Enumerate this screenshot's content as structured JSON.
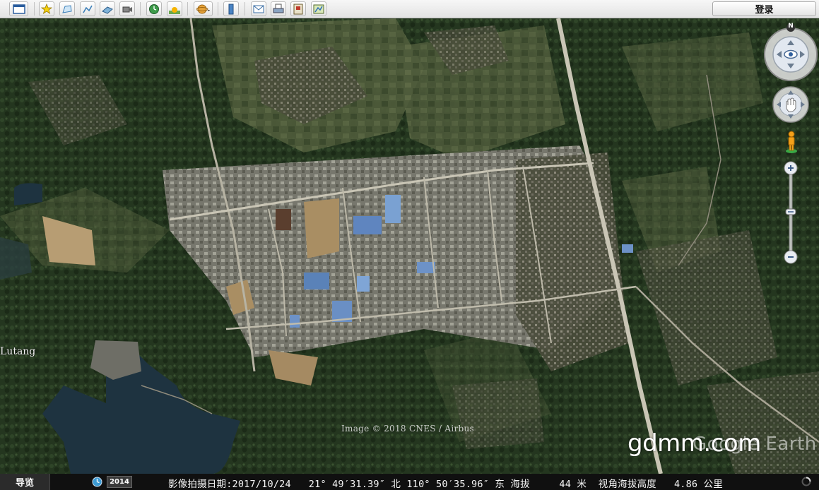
{
  "toolbar": {
    "buttons": [
      {
        "name": "sidebar-toggle-icon"
      },
      {
        "name": "add-placemark-icon"
      },
      {
        "name": "add-polygon-icon"
      },
      {
        "name": "add-path-icon"
      },
      {
        "name": "add-image-overlay-icon"
      },
      {
        "name": "record-tour-icon"
      },
      {
        "name": "historical-imagery-icon"
      },
      {
        "name": "sunlight-icon"
      },
      {
        "name": "switch-planet-icon"
      },
      {
        "name": "ruler-icon"
      },
      {
        "name": "email-icon"
      },
      {
        "name": "print-icon"
      },
      {
        "name": "save-image-icon"
      },
      {
        "name": "view-in-maps-icon"
      }
    ],
    "login_label": "登录"
  },
  "map": {
    "place_label": "Lutang",
    "imagery_credit": "Image © 2018 CNES / Airbus",
    "logo_text": "Google Earth",
    "watermark": "gdmm.com",
    "compass_north": "N"
  },
  "statusbar": {
    "nav_label": "导览",
    "year": "2014",
    "capture_date_label": "影像拍摄日期:",
    "capture_date": "2017/10/24",
    "latitude": "21° 49′31.39″ 北",
    "longitude": "110° 50′35.96″ 东",
    "elevation_label": "海拔",
    "elevation": "44 米",
    "eye_alt_label": "视角海拔高度",
    "eye_alt": "4.86 公里"
  },
  "colors": {
    "forest": "#22331f",
    "farmland": "#4f5a3a",
    "urban": "#8a8a80",
    "water": "#1e3340",
    "road": "#c9c5b5"
  }
}
